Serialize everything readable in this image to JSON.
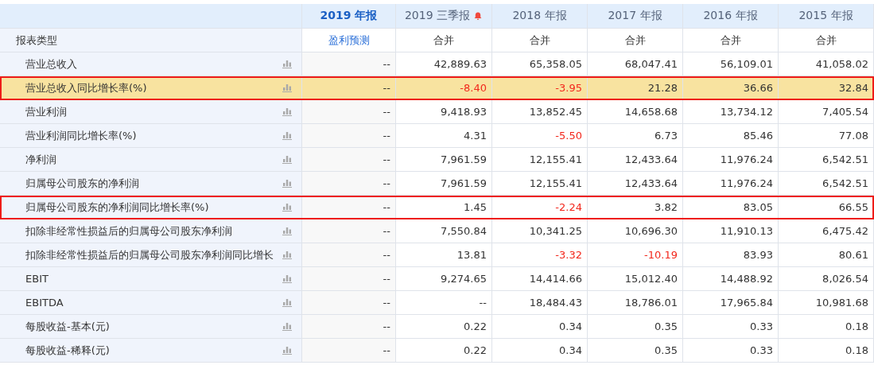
{
  "table": {
    "corner_label": "报表类型",
    "columns": [
      {
        "label": "2019 年报",
        "selected": true,
        "bell": false,
        "type_label": "盈利预测",
        "type_is_link": true
      },
      {
        "label": "2019 三季报",
        "selected": false,
        "bell": true,
        "type_label": "合并",
        "type_is_link": false
      },
      {
        "label": "2018 年报",
        "selected": false,
        "bell": false,
        "type_label": "合并",
        "type_is_link": false
      },
      {
        "label": "2017 年报",
        "selected": false,
        "bell": false,
        "type_label": "合并",
        "type_is_link": false
      },
      {
        "label": "2016 年报",
        "selected": false,
        "bell": false,
        "type_label": "合并",
        "type_is_link": false
      },
      {
        "label": "2015 年报",
        "selected": false,
        "bell": false,
        "type_label": "合并",
        "type_is_link": false
      }
    ],
    "rows": [
      {
        "label": "营业总收入",
        "highlighted": false,
        "outlined": false,
        "cells": [
          {
            "text": "--",
            "negative": false
          },
          {
            "text": "42,889.63",
            "negative": false
          },
          {
            "text": "65,358.05",
            "negative": false
          },
          {
            "text": "68,047.41",
            "negative": false
          },
          {
            "text": "56,109.01",
            "negative": false
          },
          {
            "text": "41,058.02",
            "negative": false
          }
        ]
      },
      {
        "label": "营业总收入同比增长率(%)",
        "highlighted": true,
        "outlined": true,
        "cells": [
          {
            "text": "--",
            "negative": false
          },
          {
            "text": "-8.40",
            "negative": true
          },
          {
            "text": "-3.95",
            "negative": true
          },
          {
            "text": "21.28",
            "negative": false
          },
          {
            "text": "36.66",
            "negative": false
          },
          {
            "text": "32.84",
            "negative": false
          }
        ]
      },
      {
        "label": "营业利润",
        "highlighted": false,
        "outlined": false,
        "cells": [
          {
            "text": "--",
            "negative": false
          },
          {
            "text": "9,418.93",
            "negative": false
          },
          {
            "text": "13,852.45",
            "negative": false
          },
          {
            "text": "14,658.68",
            "negative": false
          },
          {
            "text": "13,734.12",
            "negative": false
          },
          {
            "text": "7,405.54",
            "negative": false
          }
        ]
      },
      {
        "label": "营业利润同比增长率(%)",
        "highlighted": false,
        "outlined": false,
        "cells": [
          {
            "text": "--",
            "negative": false
          },
          {
            "text": "4.31",
            "negative": false
          },
          {
            "text": "-5.50",
            "negative": true
          },
          {
            "text": "6.73",
            "negative": false
          },
          {
            "text": "85.46",
            "negative": false
          },
          {
            "text": "77.08",
            "negative": false
          }
        ]
      },
      {
        "label": "净利润",
        "highlighted": false,
        "outlined": false,
        "cells": [
          {
            "text": "--",
            "negative": false
          },
          {
            "text": "7,961.59",
            "negative": false
          },
          {
            "text": "12,155.41",
            "negative": false
          },
          {
            "text": "12,433.64",
            "negative": false
          },
          {
            "text": "11,976.24",
            "negative": false
          },
          {
            "text": "6,542.51",
            "negative": false
          }
        ]
      },
      {
        "label": "归属母公司股东的净利润",
        "highlighted": false,
        "outlined": false,
        "cells": [
          {
            "text": "--",
            "negative": false
          },
          {
            "text": "7,961.59",
            "negative": false
          },
          {
            "text": "12,155.41",
            "negative": false
          },
          {
            "text": "12,433.64",
            "negative": false
          },
          {
            "text": "11,976.24",
            "negative": false
          },
          {
            "text": "6,542.51",
            "negative": false
          }
        ]
      },
      {
        "label": "归属母公司股东的净利润同比增长率(%)",
        "highlighted": false,
        "outlined": true,
        "cells": [
          {
            "text": "--",
            "negative": false
          },
          {
            "text": "1.45",
            "negative": false
          },
          {
            "text": "-2.24",
            "negative": true
          },
          {
            "text": "3.82",
            "negative": false
          },
          {
            "text": "83.05",
            "negative": false
          },
          {
            "text": "66.55",
            "negative": false
          }
        ]
      },
      {
        "label": "扣除非经常性损益后的归属母公司股东净利润",
        "highlighted": false,
        "outlined": false,
        "cells": [
          {
            "text": "--",
            "negative": false
          },
          {
            "text": "7,550.84",
            "negative": false
          },
          {
            "text": "10,341.25",
            "negative": false
          },
          {
            "text": "10,696.30",
            "negative": false
          },
          {
            "text": "11,910.13",
            "negative": false
          },
          {
            "text": "6,475.42",
            "negative": false
          }
        ]
      },
      {
        "label": "扣除非经常性损益后的归属母公司股东净利润同比增长",
        "highlighted": false,
        "outlined": false,
        "cells": [
          {
            "text": "--",
            "negative": false
          },
          {
            "text": "13.81",
            "negative": false
          },
          {
            "text": "-3.32",
            "negative": true
          },
          {
            "text": "-10.19",
            "negative": true
          },
          {
            "text": "83.93",
            "negative": false
          },
          {
            "text": "80.61",
            "negative": false
          }
        ]
      },
      {
        "label": "EBIT",
        "highlighted": false,
        "outlined": false,
        "cells": [
          {
            "text": "--",
            "negative": false
          },
          {
            "text": "9,274.65",
            "negative": false
          },
          {
            "text": "14,414.66",
            "negative": false
          },
          {
            "text": "15,012.40",
            "negative": false
          },
          {
            "text": "14,488.92",
            "negative": false
          },
          {
            "text": "8,026.54",
            "negative": false
          }
        ]
      },
      {
        "label": "EBITDA",
        "highlighted": false,
        "outlined": false,
        "cells": [
          {
            "text": "--",
            "negative": false
          },
          {
            "text": "--",
            "negative": false
          },
          {
            "text": "18,484.43",
            "negative": false
          },
          {
            "text": "18,786.01",
            "negative": false
          },
          {
            "text": "17,965.84",
            "negative": false
          },
          {
            "text": "10,981.68",
            "negative": false
          }
        ]
      },
      {
        "label": "每股收益-基本(元)",
        "highlighted": false,
        "outlined": false,
        "cells": [
          {
            "text": "--",
            "negative": false
          },
          {
            "text": "0.22",
            "negative": false
          },
          {
            "text": "0.34",
            "negative": false
          },
          {
            "text": "0.35",
            "negative": false
          },
          {
            "text": "0.33",
            "negative": false
          },
          {
            "text": "0.18",
            "negative": false
          }
        ]
      },
      {
        "label": "每股收益-稀释(元)",
        "highlighted": false,
        "outlined": false,
        "cells": [
          {
            "text": "--",
            "negative": false
          },
          {
            "text": "0.22",
            "negative": false
          },
          {
            "text": "0.34",
            "negative": false
          },
          {
            "text": "0.35",
            "negative": false
          },
          {
            "text": "0.33",
            "negative": false
          },
          {
            "text": "0.18",
            "negative": false
          }
        ]
      }
    ]
  }
}
